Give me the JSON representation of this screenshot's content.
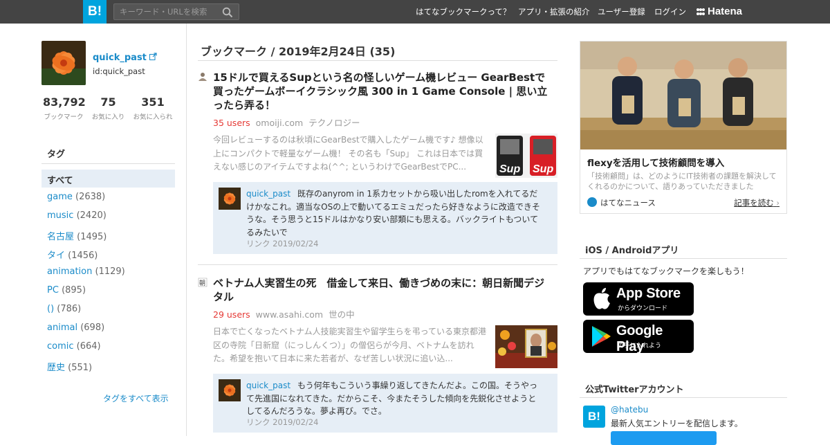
{
  "header": {
    "logo": "B!",
    "search_placeholder": "キーワード・URLを検索",
    "nav": [
      "はてなブックマークって？",
      "アプリ・拡張の紹介",
      "ユーザー登録",
      "ログイン"
    ],
    "hatena": "Hatena"
  },
  "profile": {
    "name": "quick_past",
    "id": "id:quick_past",
    "stats": [
      {
        "num": "83,792",
        "label": "ブックマーク"
      },
      {
        "num": "75",
        "label": "お気に入り"
      },
      {
        "num": "351",
        "label": "お気に入られ"
      }
    ]
  },
  "tags": {
    "heading": "タグ",
    "all": "すべて",
    "items": [
      {
        "name": "game",
        "count": "(2638)"
      },
      {
        "name": "music",
        "count": "(2420)"
      },
      {
        "name": "名古屋",
        "count": "(1495)"
      },
      {
        "name": "タイ",
        "count": "(1456)"
      },
      {
        "name": "animation",
        "count": "(1129)"
      },
      {
        "name": "PC",
        "count": "(895)"
      },
      {
        "name": "()",
        "count": "(786)"
      },
      {
        "name": "animal",
        "count": "(698)"
      },
      {
        "name": "comic",
        "count": "(664)"
      },
      {
        "name": "歴史",
        "count": "(551)"
      }
    ],
    "more": "タグをすべて表示"
  },
  "main": {
    "title": "ブックマーク / 2019年2月24日 (35)",
    "entries": [
      {
        "title": "15ドルで買えるSupという名の怪しいゲーム機レビュー GearBestで買ったゲームボーイクラシック風 300 in 1 Game Console | 思い立ったら弄る！",
        "users": "35 users",
        "domain": "omoiji.com",
        "category": "テクノロジー",
        "description": "今回レビューするのは秋頃にGearBestで購入したゲーム機です♪ 想像以上にコンパクトで軽量なゲーム機！ その名も「Sup」 これは日本では買えない感じのアイテムですよね(^^; というわけでGearBestでPC...",
        "comment_user": "quick_past",
        "comment": "既存のanyrom in 1系カセットから吸い出したromを入れてるだけかなこれ。適当なOSの上で動いてるエミュだったら好きなように改造できそうな。そう思うと15ドルはかなり安い部類にも思える。バックライトもついてるみたいで",
        "comment_meta": "リンク 2019/02/24"
      },
      {
        "title": "ベトナム人実習生の死　借金して来日、働きづめの末に：朝日新聞デジタル",
        "users": "29 users",
        "domain": "www.asahi.com",
        "category": "世の中",
        "description": "日本で亡くなったベトナム人技能実習生や留学生らを弔っている東京都港区の寺院「日新窟（にっしんくつ）」の僧侶らが今月、ベトナムを訪れた。希望を抱いて日本に来た若者が、なぜ苦しい状況に追い込...",
        "comment_user": "quick_past",
        "comment": "もう何年もこういう事繰り返してきたんだよ。この国。そうやって先進国になれてきた。だからこそ、今またそうした傾向を先鋭化させようとしてるんだろうな。夢よ再び。でさ。",
        "comment_meta": "リンク 2019/02/24"
      }
    ]
  },
  "right": {
    "ad_title": "flexyを活用して技術顧問を導入",
    "ad_desc": "「技術顧問」は、どのようにIT技術者の課題を解決してくれるのかについて、語りあっていただきました",
    "ad_source": "はてなニュース",
    "ad_more": "記事を読む",
    "apps_heading": "iOS / Androidアプリ",
    "apps_desc": "アプリでもはてなブックマークを楽しもう！",
    "appstore_big": "App Store",
    "appstore_small": "からダウンロード",
    "gplay_big": "Google Play",
    "gplay_small": "で手に入れよう",
    "twitter_heading": "公式Twitterアカウント",
    "twitter_handle": "@hatebu",
    "twitter_desc": "最新人気エントリーを配信します。"
  },
  "colors": {
    "header_bg": "#444444",
    "brand": "#00a4de",
    "link": "#1a8bc9",
    "users": "#e53935",
    "comment_bg": "#e6eef6"
  }
}
